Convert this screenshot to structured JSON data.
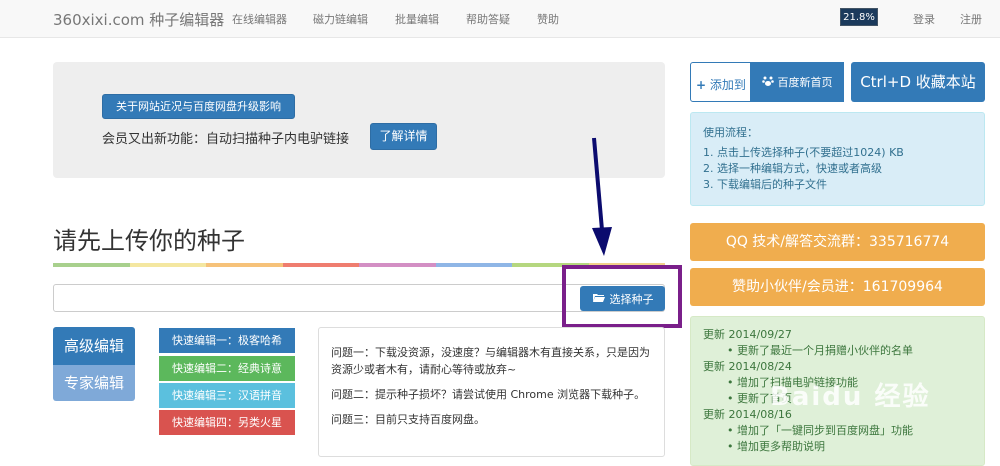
{
  "nav": {
    "brand": "360xixi.com 种子编辑器",
    "links": [
      "在线编辑器",
      "磁力链编辑",
      "批量编辑",
      "帮助答疑",
      "赞助"
    ],
    "percent": "21.8%",
    "login": "登录",
    "register": "注册"
  },
  "notice": {
    "button_label": "关于网站近况与百度网盘升级影响",
    "text": "会员又出新功能：自动扫描种子内电驴链接",
    "detail_button": "了解详情"
  },
  "upload": {
    "title": "请先上传你的种子",
    "choose_button": "选择种子"
  },
  "modes": {
    "advanced": "高级编辑",
    "expert": "专家编辑"
  },
  "quick_edits": [
    {
      "label": "快速编辑一：极客哈希",
      "color": "#337ab7"
    },
    {
      "label": "快速编辑二：经典诗意",
      "color": "#5cb85c"
    },
    {
      "label": "快速编辑三：汉语拼音",
      "color": "#5bc0de"
    },
    {
      "label": "快速编辑四：另类火星",
      "color": "#d9534f"
    }
  ],
  "faq": [
    "问题一：下载没资源，没速度？与编辑器木有直接关系，只是因为资源少或者木有，请耐心等待或放弃~",
    "问题二：提示种子损坏？请尝试使用 Chrome 浏览器下载种子。",
    "问题三：目前只支持百度网盘。"
  ],
  "sidebar": {
    "add_label": "添加到",
    "baidu_label": "百度新首页",
    "fav_label": "Ctrl+D 收藏本站",
    "howto_title": "使用流程：",
    "howto_steps": [
      "1. 点击上传选择种子(不要超过1024) KB",
      "2. 选择一种编辑方式，快速或者高级",
      "3. 下载编辑后的种子文件"
    ],
    "qq_group": "QQ 技术/解答交流群：335716774",
    "sponsor": "赞助小伙伴/会员进：161709964",
    "changelog": [
      {
        "date": "更新 2014/09/27",
        "items": [
          "更新了最近一个月捐赠小伙伴的名单"
        ]
      },
      {
        "date": "更新 2014/08/24",
        "items": [
          "增加了扫描电驴链接功能",
          "更新了首页"
        ]
      },
      {
        "date": "更新 2014/08/16",
        "items": [
          "增加了「一键同步到百度网盘」功能",
          "增加更多帮助说明"
        ]
      }
    ]
  },
  "watermark": "Baidu 经验",
  "colors": {
    "primary": "#337ab7",
    "warning": "#f0ad4e",
    "highlight": "#7a1f8a",
    "arrow": "#0b0b6e"
  }
}
